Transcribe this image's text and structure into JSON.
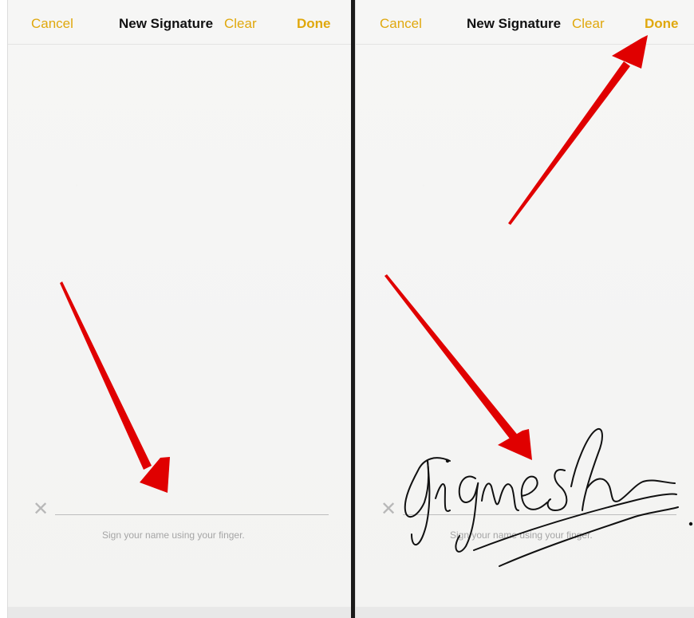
{
  "left_panel": {
    "cancel_label": "Cancel",
    "title": "New Signature",
    "clear_label": "Clear",
    "done_label": "Done",
    "clear_icon": "x-icon",
    "hint": "Sign your name using your finger."
  },
  "right_panel": {
    "cancel_label": "Cancel",
    "title": "New Signature",
    "clear_label": "Clear",
    "done_label": "Done",
    "clear_icon": "x-icon",
    "hint": "Sign your name using your finger.",
    "signature_text": "Jignesh"
  },
  "colors": {
    "accent": "#e0a80d",
    "annotation_arrow": "#e00000",
    "signature_ink": "#111111"
  }
}
